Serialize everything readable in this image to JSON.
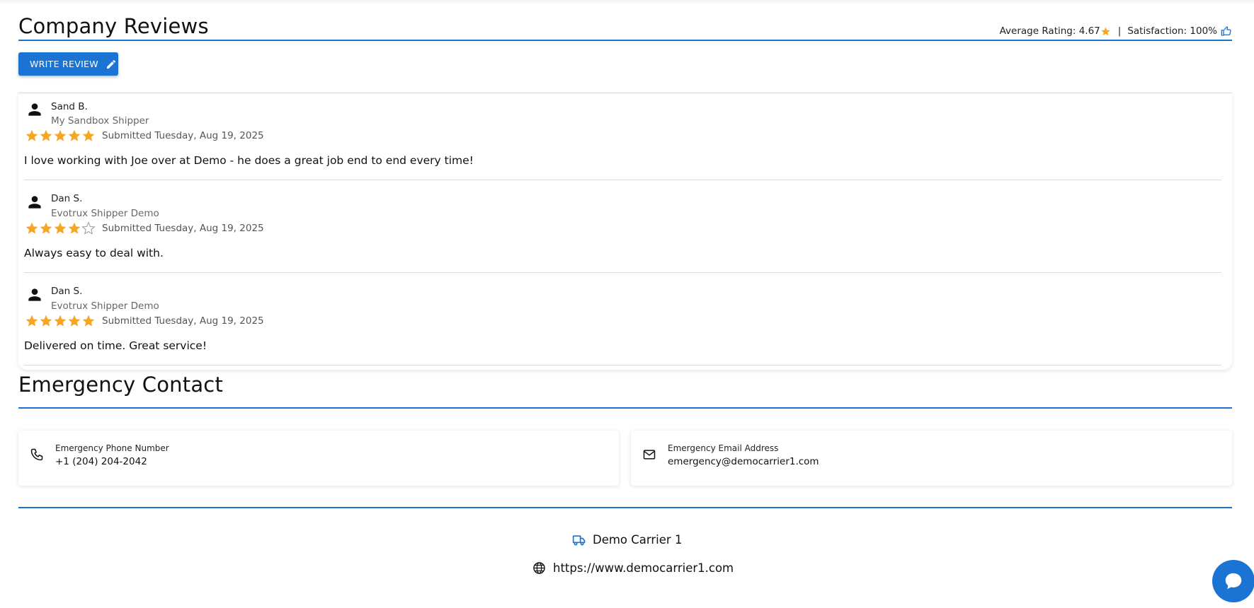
{
  "colors": {
    "accent": "#1b74d4",
    "star": "#f5a623",
    "star_empty": "#9e9e9e"
  },
  "reviews_section": {
    "title": "Company Reviews",
    "average_rating_label": "Average Rating: 4.67",
    "separator": "|",
    "satisfaction_label": "Satisfaction: 100%",
    "write_review_label": "WRITE REVIEW",
    "icons": {
      "average": "star-icon",
      "satisfaction": "thumbs-up-icon",
      "write": "pencil-icon",
      "reviewer": "person-icon"
    },
    "reviews": [
      {
        "name": "Sand B.",
        "company": "My Sandbox Shipper",
        "rating": 5,
        "submitted": "Submitted Tuesday, Aug 19, 2025",
        "text": "I love working with Joe over at Demo - he does a great job end to end every time!"
      },
      {
        "name": "Dan S.",
        "company": "Evotrux Shipper Demo",
        "rating": 4,
        "submitted": "Submitted Tuesday, Aug 19, 2025",
        "text": "Always easy to deal with."
      },
      {
        "name": "Dan S.",
        "company": "Evotrux Shipper Demo",
        "rating": 5,
        "submitted": "Submitted Tuesday, Aug 19, 2025",
        "text": "Delivered on time. Great service!"
      }
    ]
  },
  "emergency_section": {
    "title": "Emergency Contact",
    "phone": {
      "label": "Emergency Phone Number",
      "value": "+1 (204) 204-2042",
      "icon": "phone-icon"
    },
    "email": {
      "label": "Emergency Email Address",
      "value": "emergency@democarrier1.com",
      "icon": "mail-icon"
    }
  },
  "footer": {
    "company_name": "Demo Carrier 1",
    "website": "https://www.democarrier1.com",
    "icons": {
      "company": "truck-icon",
      "website": "globe-icon"
    }
  },
  "chat": {
    "icon": "chat-bubble-icon"
  }
}
